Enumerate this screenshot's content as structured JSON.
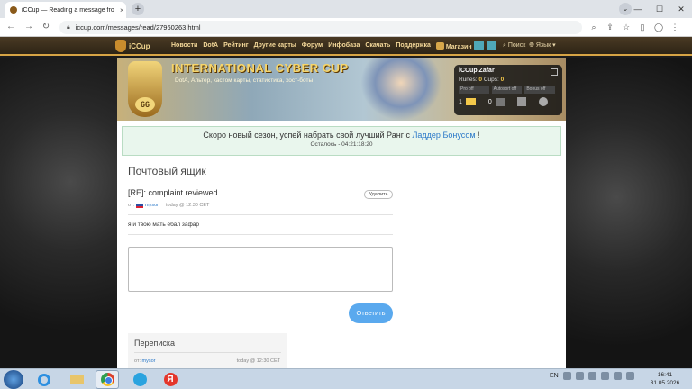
{
  "browser": {
    "tab_title": "iCCup — Reading a message fro",
    "tab_close": "×",
    "new_tab": "+",
    "url": "iccup.com/messages/read/27960263.html",
    "window_controls": [
      "—",
      "☐",
      "✕"
    ],
    "dropdown": "⌄"
  },
  "site": {
    "brand": "iCCup",
    "menu": [
      "Новости",
      "DotA",
      "Рейтинг",
      "Другие карты",
      "Форум",
      "Инфобаза",
      "Скачать",
      "Поддержка",
      "Магазин"
    ],
    "search": "Поиск",
    "language": "Язык",
    "banner_title": "INTERNATIONAL CYBER CUP",
    "banner_subtitle": "DotA, Альтер, кастом карты, статистика, хост-боты",
    "level": "66"
  },
  "user": {
    "name": "iCCup.Zafar",
    "runes_label": "Runes:",
    "runes_value": "0",
    "cups_label": "Cups:",
    "cups_value": "0",
    "pro": "Pro off",
    "autosort": "Autosort off",
    "bonus": "Bonus off",
    "mail_count": "1",
    "warn_count": "0"
  },
  "notice": {
    "text_before": "Скоро новый сезон, успей набрать свой лучший Ранг с",
    "link": "Ладдер Бонусом",
    "text_after": "!",
    "countdown": "Осталось - 04:21:18:20"
  },
  "mailbox": {
    "title": "Почтовый ящик",
    "subject": "[RE]: complaint reviewed",
    "delete_label": "Удалить",
    "from_label": "от:",
    "from_user": "mysor",
    "time": "today @ 12:30 CET",
    "body": "я и твою мать ебал зафар",
    "send_label": "Ответить"
  },
  "thread": {
    "title": "Переписка",
    "from_label": "от:",
    "from_user": "mysor",
    "time": "today @ 12:30 CET"
  },
  "taskbar": {
    "lang": "EN",
    "time": "16:41",
    "date": "31.05.2026"
  }
}
